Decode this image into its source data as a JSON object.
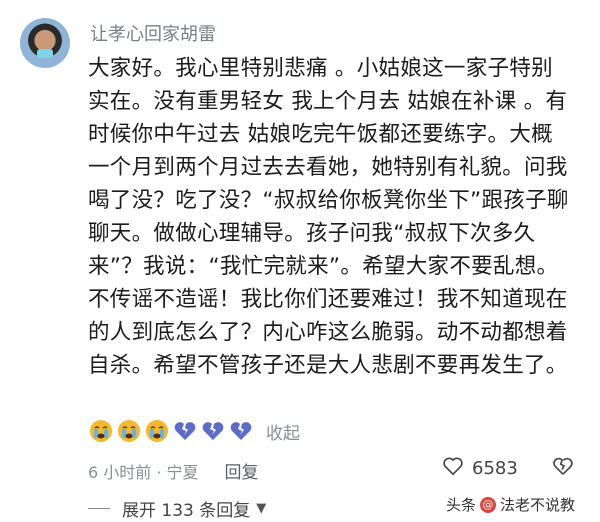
{
  "comment": {
    "username": "让孝心回家胡雷",
    "lines": [
      "大家好。我心里特别悲痛 。小姑娘这一家子特别",
      "实在。没有重男轻女 我上个月去 姑娘在补课 。有",
      "时候你中午过去 姑娘吃完午饭都还要练字。大概",
      "一个月到两个月过去去看她，她特别有礼貌。问我",
      "喝了没？吃了没？“叔叔给你板凳你坐下”跟孩子聊",
      "聊天。做做心理辅导。孩子问我“叔叔下次多久",
      "来”？我说：“我忙完就来”。希望大家不要乱想。",
      "不传谣不造谣！我比你们还要难过！我不知道现在",
      "的人到底怎么了？内心咋这么脆弱。动不动都想着",
      "自杀。希望不管孩子还是大人悲剧不要再发生了。"
    ],
    "reactions": [
      "crying-face",
      "crying-face",
      "crying-face",
      "broken-heart",
      "broken-heart",
      "broken-heart"
    ],
    "collapse_label": "收起",
    "time_location": "6 小时前 · 宁夏",
    "reply_label": "回复",
    "like_count": "6583",
    "expand_label": "展开 133 条回复"
  },
  "watermark": {
    "platform": "头条",
    "account": "法老不说教"
  },
  "colors": {
    "meta_gray": "#8a8f96",
    "broken_heart": "#5b6cc9",
    "crying_face": "#f5b72b"
  }
}
